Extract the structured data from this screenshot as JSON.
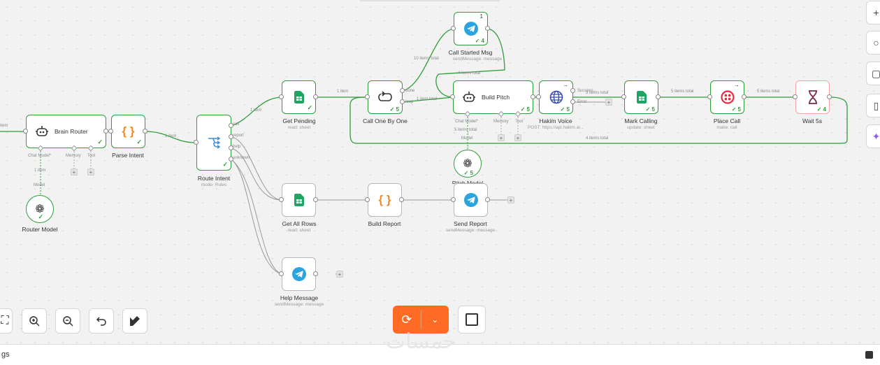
{
  "nodes": {
    "brain_router": {
      "title": "Brain Router",
      "icon": "robot-icon"
    },
    "router_model": {
      "title": "Router Model",
      "icon": "openai-icon"
    },
    "parse_intent": {
      "title": "Parse Intent",
      "icon": "code-braces-icon"
    },
    "route_intent": {
      "title": "Route Intent",
      "subtitle": "mode: Rules",
      "icon": "switch-icon"
    },
    "get_pending": {
      "title": "Get Pending",
      "subtitle": "read: sheet",
      "icon": "google-sheets-icon"
    },
    "call_one_by_one": {
      "title": "Call One By One",
      "badge": "5",
      "icon": "loop-icon"
    },
    "call_started_msg": {
      "title": "Call Started Msg",
      "subtitle": "sendMessage: message",
      "badge": "4",
      "top_badge": "1",
      "icon": "telegram-icon"
    },
    "build_pitch": {
      "title": "Build Pitch",
      "badge": "5",
      "icon": "robot-icon"
    },
    "pitch_model": {
      "title": "Pitch Model",
      "badge": "5",
      "icon": "openai-icon"
    },
    "hakim_voice": {
      "title": "Hakim Voice",
      "subtitle": "POST: https://api.hakim.ai...",
      "badge": "5",
      "icon": "globe-icon"
    },
    "mark_calling": {
      "title": "Mark Calling",
      "subtitle": "update: sheet",
      "badge": "5",
      "icon": "google-sheets-icon"
    },
    "place_call": {
      "title": "Place Call",
      "subtitle": "make: call",
      "badge": "5",
      "icon": "twilio-icon"
    },
    "wait_5s": {
      "title": "Wait 5s",
      "badge": "4",
      "icon": "hourglass-icon"
    },
    "get_all_rows": {
      "title": "Get All Rows",
      "subtitle": "read: sheet",
      "icon": "google-sheets-icon"
    },
    "build_report": {
      "title": "Build Report",
      "icon": "code-braces-icon"
    },
    "send_report": {
      "title": "Send Report",
      "subtitle": "sendMessage: message",
      "icon": "telegram-icon"
    },
    "help_message": {
      "title": "Help Message",
      "subtitle": "sendMessage: message",
      "icon": "telegram-icon"
    }
  },
  "edge_labels": {
    "input_items": "item",
    "brain_to_parse": "item",
    "parse_to_route": "1 item",
    "route_to_pending": "1 item",
    "pending_to_loop": "1 item",
    "loop_to_pitch": "1 item total",
    "loop_to_msg": "10 items total",
    "msg_to_pitch": "4 items total",
    "pitch_to_voice": "5 items total",
    "voice_to_mark": "5 items total",
    "mark_to_call": "5 items total",
    "call_to_wait": "5 items total",
    "wait_back": "4 items total",
    "pitch_model_link": "5 items total",
    "router_model_link": "1 item"
  },
  "ports": {
    "chat_model": "Chat Model*",
    "memory": "Memory",
    "tool": "Tool",
    "model": "Model",
    "done": "done",
    "loop": "loop",
    "success": "Success",
    "error": "Error",
    "call": "call",
    "report": "report",
    "help": "help",
    "unknown": "unknown"
  },
  "toolbar": {
    "fit_icon": "fit-view-icon",
    "zoom_in_icon": "zoom-in-icon",
    "zoom_out_icon": "zoom-out-icon",
    "undo_icon": "undo-icon",
    "clean_icon": "tidy-up-icon"
  },
  "execute": {
    "run_icon": "refresh-icon",
    "menu_icon": "chevron-down-icon",
    "stop_icon": "stop-icon"
  },
  "bottom": {
    "logs_label": "gs",
    "watermark": "خمسات"
  },
  "colors": {
    "success": "#2e9d3a",
    "accent": "#ff6b24"
  }
}
